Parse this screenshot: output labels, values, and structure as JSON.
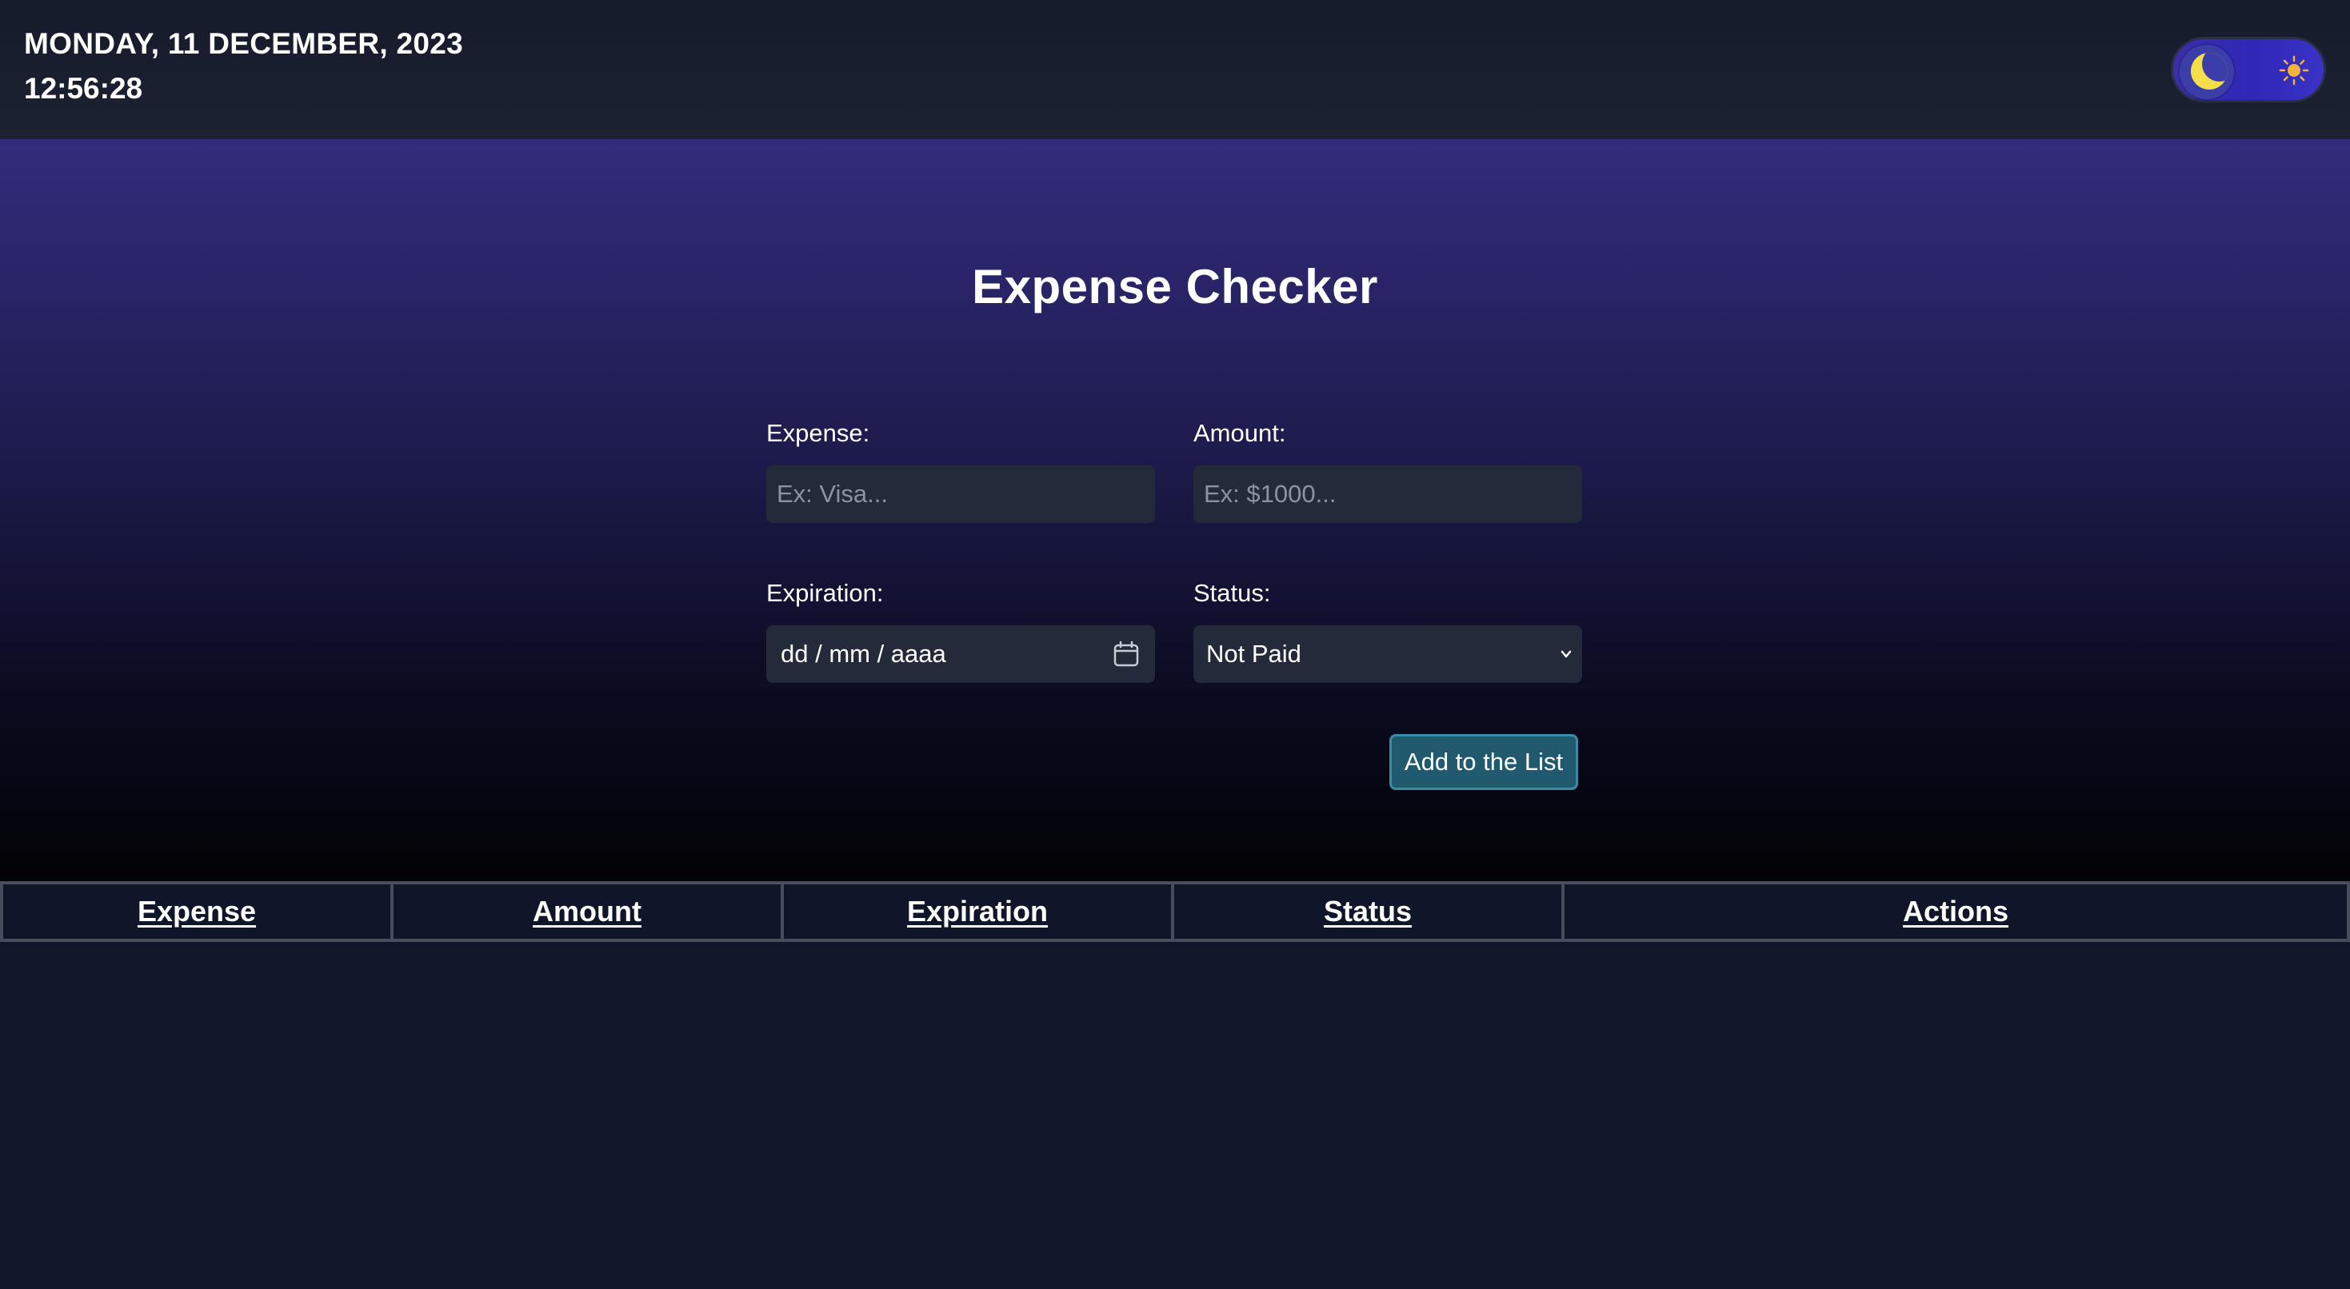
{
  "header": {
    "date": "MONDAY, 11 DECEMBER, 2023",
    "time": "12:56:28",
    "theme_toggle": {
      "state": "dark",
      "icons": [
        "moon-icon",
        "sun-icon"
      ]
    }
  },
  "main": {
    "title": "Expense Checker",
    "form": {
      "expense": {
        "label": "Expense:",
        "placeholder": "Ex: Visa...",
        "value": ""
      },
      "amount": {
        "label": "Amount:",
        "placeholder": "Ex: $1000...",
        "value": ""
      },
      "expiration": {
        "label": "Expiration:",
        "placeholder": "dd / mm / aaaa",
        "icon": "calendar-icon"
      },
      "status": {
        "label": "Status:",
        "selected": "Not Paid",
        "icon": "chevron-down-icon"
      },
      "submit_label": "Add to the List"
    }
  },
  "table": {
    "columns": [
      "Expense",
      "Amount",
      "Expiration",
      "Status",
      "Actions"
    ],
    "rows": []
  },
  "colors": {
    "background": "#111729",
    "button": "#215a6f",
    "button_border": "#3b8aa6",
    "moon": "#f6dd4a",
    "sun": "#f2b43a",
    "toggle": "#2e27b8"
  }
}
